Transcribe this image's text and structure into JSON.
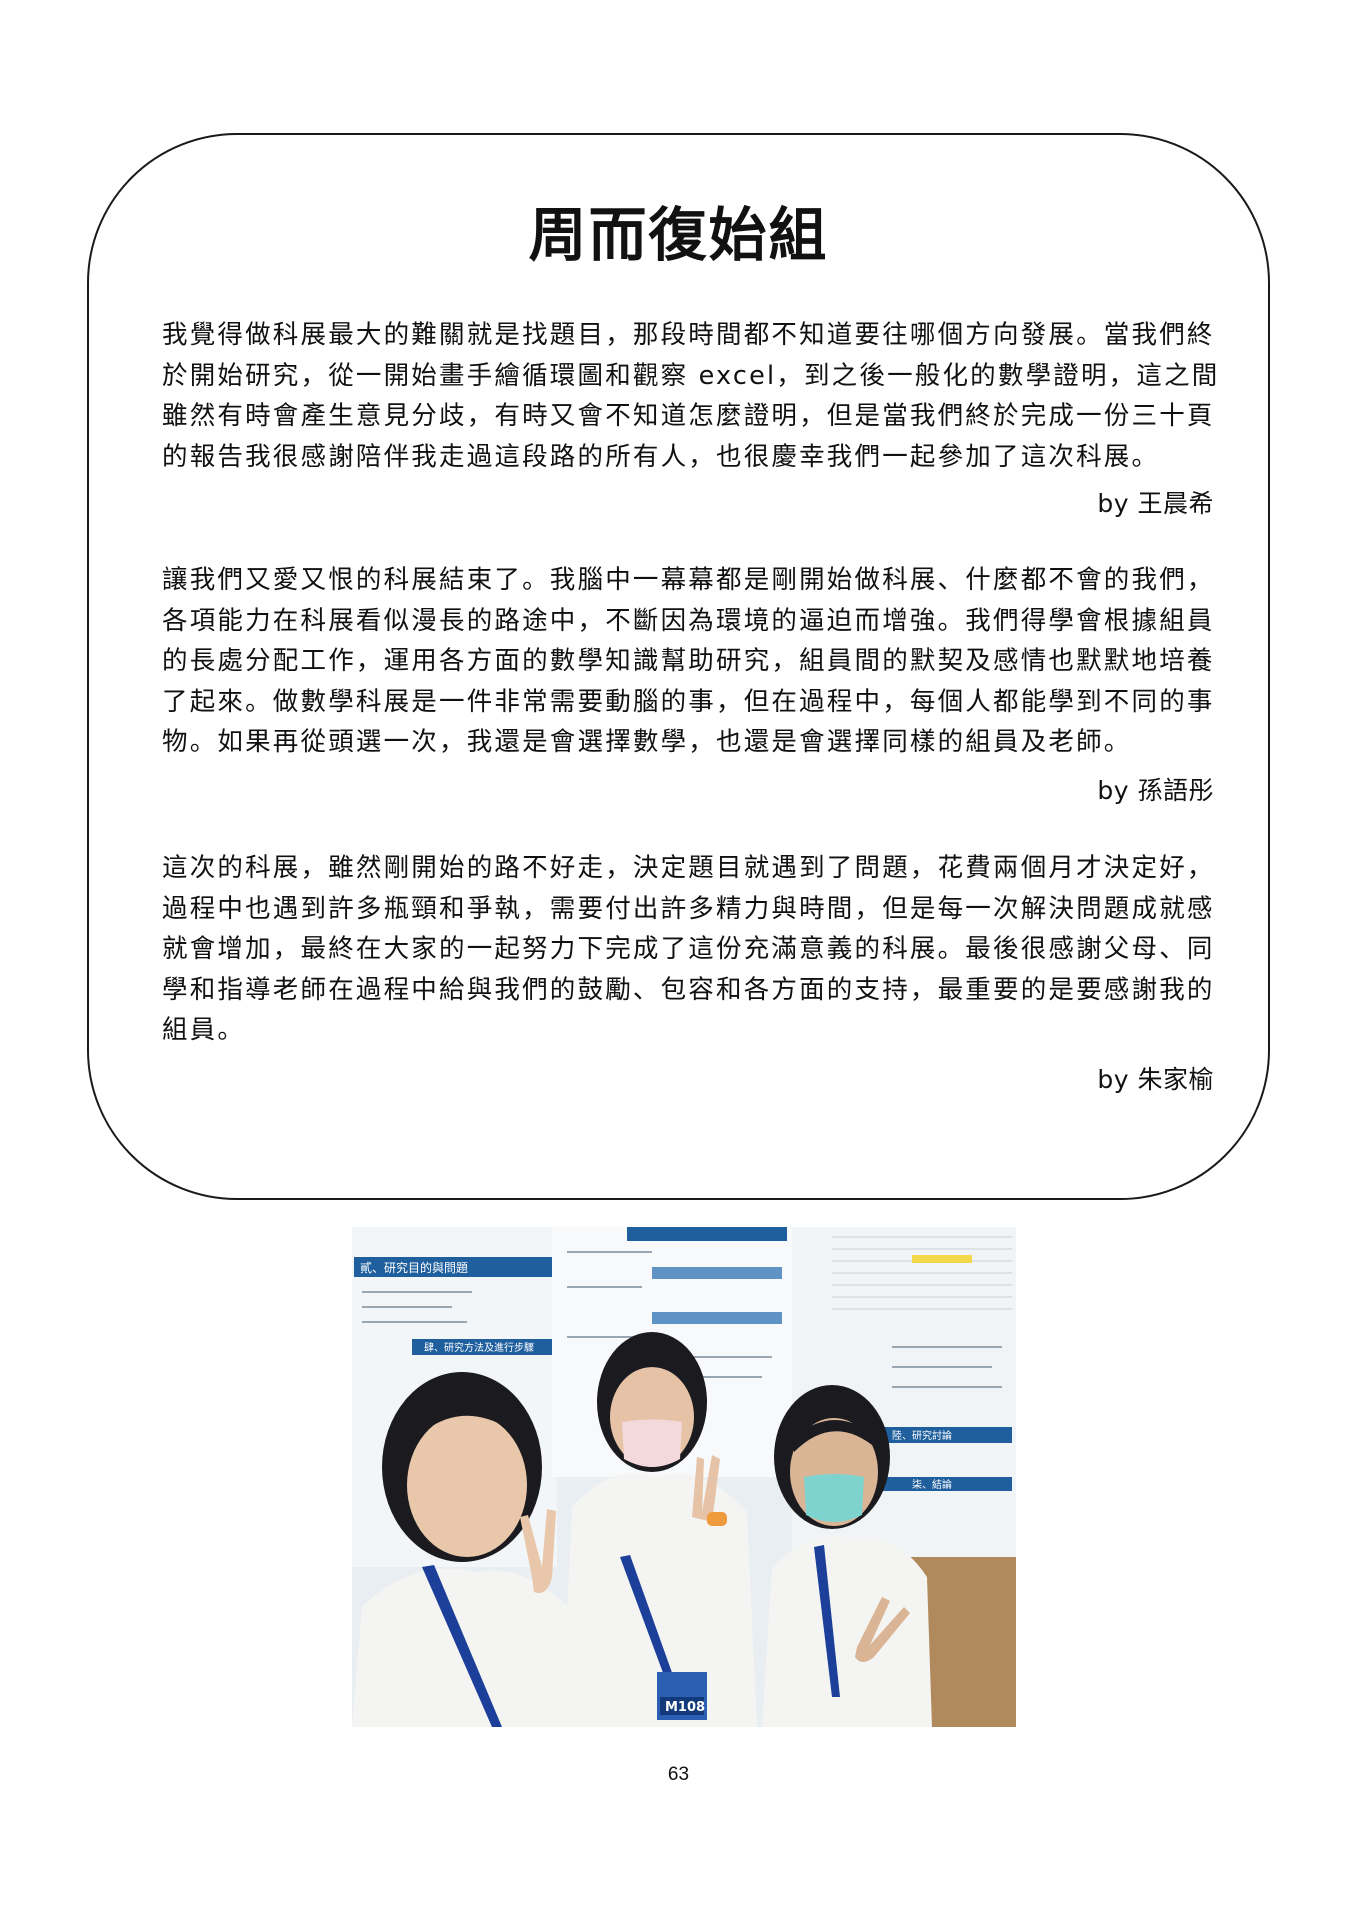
{
  "title": "周而復始組",
  "entries": [
    {
      "lines": [
        "我覺得做科展最大的難關就是找題目，那段時間都不知道要往哪個方向發展。當我們終",
        "於開始研究，從一開始畫手繪循環圖和觀察 excel，到之後一般化的數學證明，這之間",
        "雖然有時會產生意見分歧，有時又會不知道怎麼證明，但是當我們終於完成一份三十頁",
        "的報告我很感謝陪伴我走過這段路的所有人，也很慶幸我們一起參加了這次科展。"
      ],
      "author": "by 王晨希"
    },
    {
      "lines": [
        "讓我們又愛又恨的科展結束了。我腦中一幕幕都是剛開始做科展、什麼都不會的我們，",
        "各項能力在科展看似漫長的路途中，不斷因為環境的逼迫而增強。我們得學會根據組員",
        "的長處分配工作，運用各方面的數學知識幫助研究，組員間的默契及感情也默默地培養",
        "了起來。做數學科展是一件非常需要動腦的事，但在過程中，每個人都能學到不同的事",
        "物。如果再從頭選一次，我還是會選擇數學，也還是會選擇同樣的組員及老師。"
      ],
      "author": "by 孫語彤"
    },
    {
      "lines": [
        "這次的科展，雖然剛開始的路不好走，決定題目就遇到了問題，花費兩個月才決定好，",
        "過程中也遇到許多瓶頸和爭執，需要付出許多精力與時間，但是每一次解決問題成就感",
        "就會增加，最終在大家的一起努力下完成了這份充滿意義的科展。最後很感謝父母、同",
        "學和指導老師在過程中給與我們的鼓勵、包容和各方面的支持，最重要的是要感謝我的",
        "組員。"
      ],
      "author": "by 朱家榆"
    }
  ],
  "photo": {
    "poster_headings": [
      "貳、研究目的與問題",
      "肆、研究方法及進行步驟",
      "陸、研究討論",
      "柒、結論"
    ],
    "badge_text": "M108"
  },
  "page_number": "63",
  "colors": {
    "poster_blue": "#1f5f9e",
    "poster_bg": "#eef3f7",
    "shirt": "#f4f4f2",
    "lanyard": "#1c3f9a",
    "mask_pink": "#f3d9dc",
    "mask_teal": "#7fd3cf"
  }
}
